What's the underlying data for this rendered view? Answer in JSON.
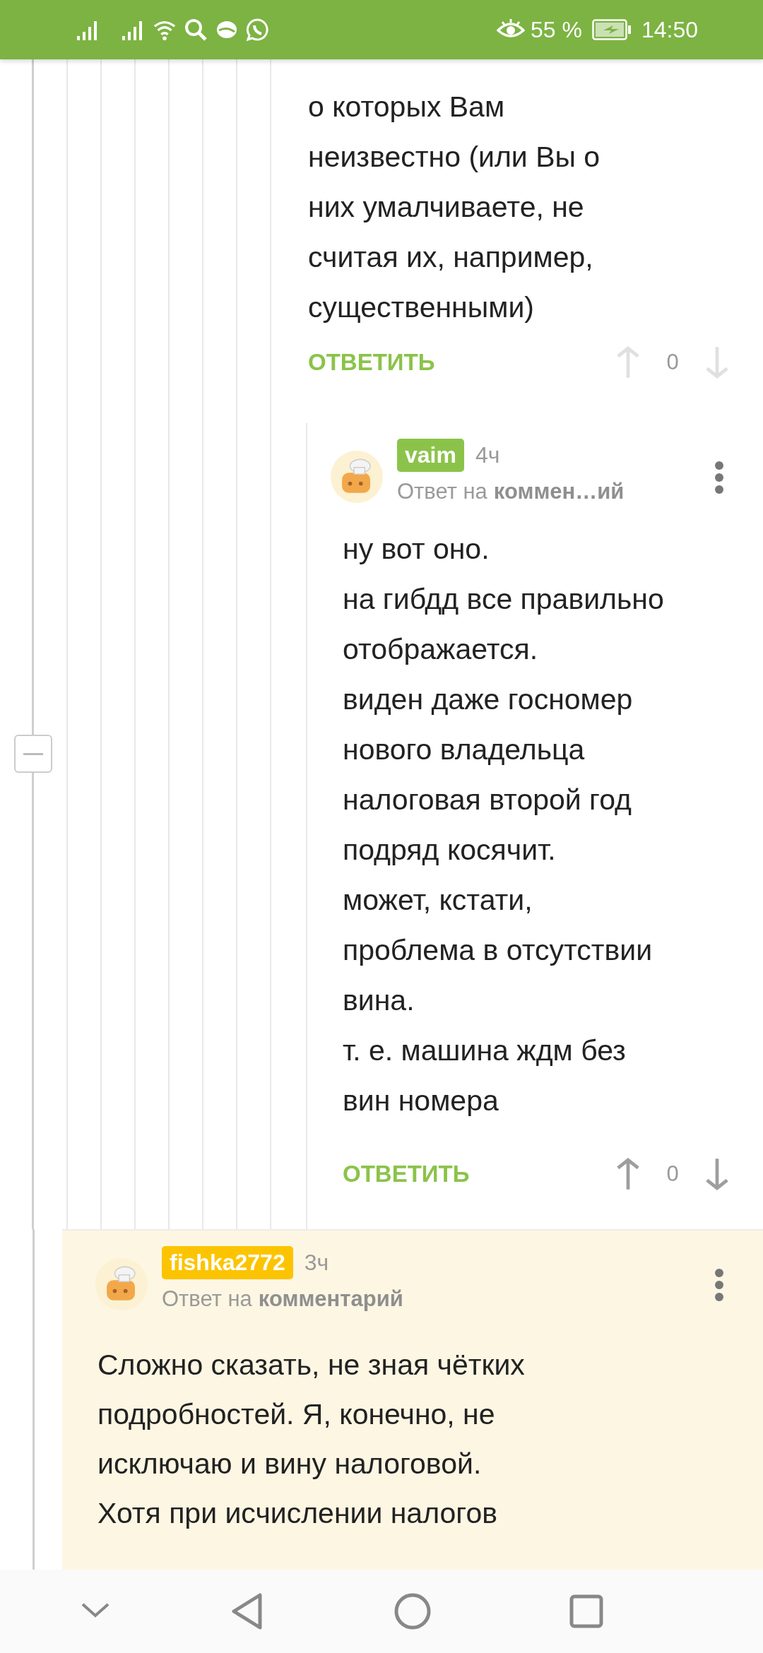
{
  "status_bar": {
    "battery_percent": "55 %",
    "time": "14:50"
  },
  "deep_thread": {
    "comments": [
      {
        "kind": "fragment",
        "text": "о которых Вам\nнеизвестно (или Вы о\nних умалчиваете, не\nсчитая их, например,\nсущественными)",
        "reply_label": "ОТВЕТИТЬ",
        "rating": "0",
        "voting_disabled": true
      },
      {
        "kind": "reply",
        "author": "vaim",
        "color": "#8bc34a",
        "time": "4ч",
        "reply_prefix": "Ответ на",
        "reply_target": "коммен…ий",
        "text": "ну вот оно.\nна гибдд все правильно\nотображается.\nвиден даже госномер\nнового владельца\nналоговая второй год\nподряд косячит.\nможет, кстати,\nпроблема в отсутствии\nвина.\nт. е. машина ждм без\nвин номера",
        "reply_label": "ОТВЕТИТЬ",
        "rating": "0",
        "voting_disabled": false
      }
    ]
  },
  "comments": [
    {
      "kind": "reply",
      "author": "fishka2772",
      "color": "#fcc400",
      "time": "3ч",
      "highlighted": true,
      "reply_prefix": "Ответ на",
      "reply_target": "комментарий",
      "text": "Сложно сказать, не зная чётких\nподробностей. Я, конечно, не\nисключаю и вину налоговой.\nХотя при исчислении налогов"
    }
  ]
}
